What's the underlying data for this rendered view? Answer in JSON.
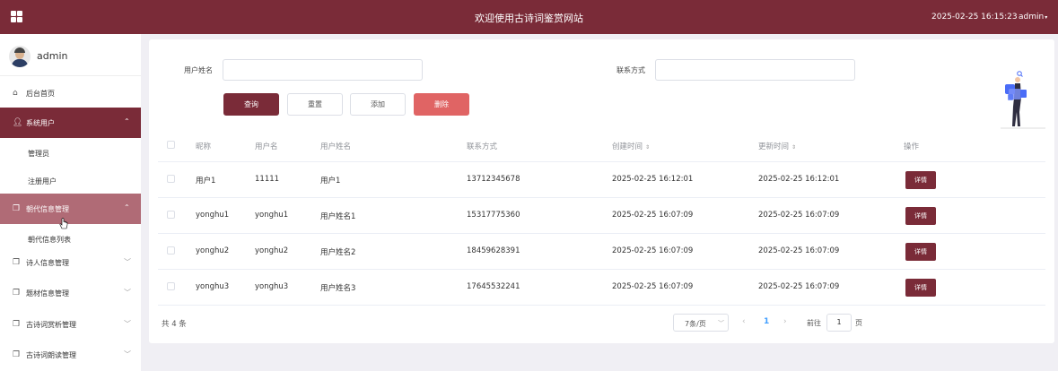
{
  "header": {
    "title": "欢迎使用古诗词鉴赏网站",
    "datetime": "2025-02-25 16:15:23",
    "user": "admin"
  },
  "sidebar": {
    "profile_name": "admin",
    "items": [
      {
        "label": "后台首页",
        "icon": "home-icon"
      },
      {
        "label": "系统用户",
        "icon": "user-icon",
        "chevron": "^"
      },
      {
        "label": "管理员"
      },
      {
        "label": "注册用户"
      },
      {
        "label": "朝代信息管理",
        "icon": "document-icon",
        "chevron": "⌃"
      },
      {
        "label": "朝代信息列表"
      },
      {
        "label": "诗人信息管理",
        "icon": "document-icon",
        "chevron": "﹀"
      },
      {
        "label": "题材信息管理",
        "icon": "document-icon",
        "chevron": "﹀"
      },
      {
        "label": "古诗词赏析管理",
        "icon": "document-icon",
        "chevron": "﹀"
      },
      {
        "label": "古诗词朗读管理",
        "icon": "document-icon",
        "chevron": "﹀"
      }
    ]
  },
  "search": {
    "name_label": "用户姓名",
    "name_value": "",
    "contact_label": "联系方式",
    "contact_value": ""
  },
  "buttons": {
    "query": "查询",
    "reset": "重置",
    "add": "添加",
    "delete": "删除"
  },
  "table": {
    "headers": [
      "昵称",
      "用户名",
      "用户姓名",
      "联系方式",
      "创建时间",
      "更新时间",
      "操作"
    ],
    "sort_glyph": "⇕",
    "detail_label": "详情",
    "rows": [
      [
        "用户1",
        "11111",
        "用户1",
        "13712345678",
        "2025-02-25 16:12:01",
        "2025-02-25 16:12:01"
      ],
      [
        "yonghu1",
        "yonghu1",
        "用户姓名1",
        "15317775360",
        "2025-02-25 16:07:09",
        "2025-02-25 16:07:09"
      ],
      [
        "yonghu2",
        "yonghu2",
        "用户姓名2",
        "18459628391",
        "2025-02-25 16:07:09",
        "2025-02-25 16:07:09"
      ],
      [
        "yonghu3",
        "yonghu3",
        "用户姓名3",
        "17645532241",
        "2025-02-25 16:07:09",
        "2025-02-25 16:07:09"
      ]
    ]
  },
  "pagination": {
    "total": "共 4 条",
    "page_size": "7条/页",
    "current_page": "1",
    "goto_label": "前往",
    "goto_value": "1",
    "page_unit": "页",
    "prev": "‹",
    "next": "›"
  },
  "colors": {
    "brand": "#7a2b38",
    "hover": "#b06b76",
    "danger": "#e06464",
    "link": "#409eff"
  }
}
